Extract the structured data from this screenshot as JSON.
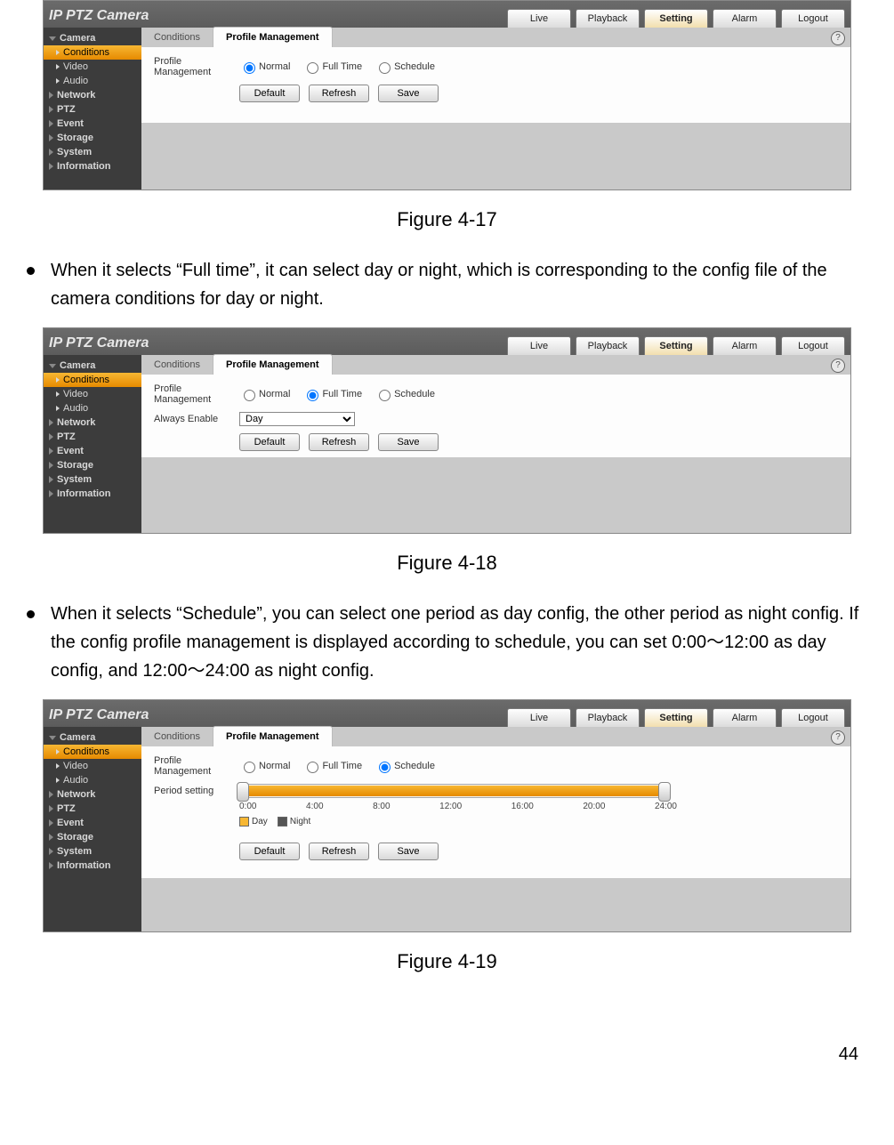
{
  "doc": {
    "caption1": "Figure 4-17",
    "caption2": "Figure 4-18",
    "caption3": "Figure 4-19",
    "bullet1": "When it selects “Full time”, it can select day or night, which is corresponding to the config file of the camera conditions for day or night.",
    "bullet2": "When it selects “Schedule”, you can select one period as day config, the other period as night config. If the config profile management is displayed according to schedule, you can set 0:00～12:00 as day config, and 12:00～24:00 as night config.",
    "pagenum": "44"
  },
  "ui": {
    "brand": "IP PTZ Camera",
    "toptabs": {
      "live": "Live",
      "playback": "Playback",
      "setting": "Setting",
      "alarm": "Alarm",
      "logout": "Logout"
    },
    "sidebar": {
      "camera": "Camera",
      "conditions": "Conditions",
      "video": "Video",
      "audio": "Audio",
      "network": "Network",
      "ptz": "PTZ",
      "event": "Event",
      "storage": "Storage",
      "system": "System",
      "information": "Information"
    },
    "subtabs": {
      "conditions": "Conditions",
      "profile": "Profile Management"
    },
    "form": {
      "pm_label": "Profile Management",
      "normal": "Normal",
      "fulltime": "Full Time",
      "schedule": "Schedule",
      "always_enable": "Always Enable",
      "day_option": "Day",
      "period_setting": "Period setting",
      "legend_day": "Day",
      "legend_night": "Night",
      "ticks": {
        "t0": "0:00",
        "t4": "4:00",
        "t8": "8:00",
        "t12": "12:00",
        "t16": "16:00",
        "t20": "20:00",
        "t24": "24:00"
      }
    },
    "buttons": {
      "default": "Default",
      "refresh": "Refresh",
      "save": "Save"
    },
    "help": "?"
  },
  "grey_heights": {
    "s1": "75",
    "s2": "85",
    "s3": "60"
  }
}
